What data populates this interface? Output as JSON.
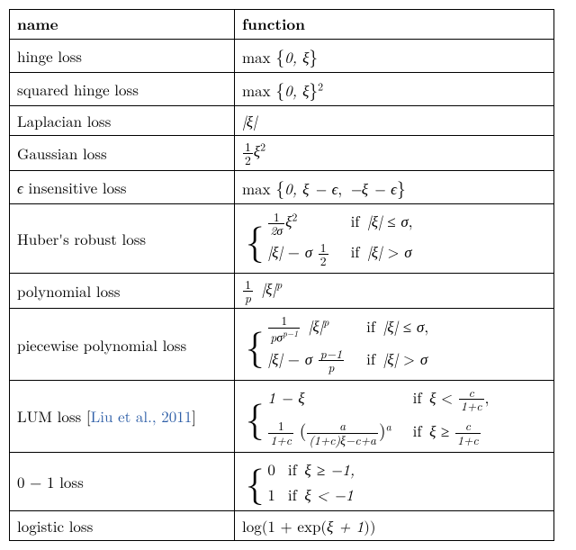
{
  "headers": {
    "name": "name",
    "function": "function"
  },
  "rows": {
    "hinge": {
      "name": "hinge loss"
    },
    "sqhinge": {
      "name": "squared hinge loss"
    },
    "laplacian": {
      "name": "Laplacian loss"
    },
    "gaussian": {
      "name": "Gaussian loss"
    },
    "eps": {
      "name_pre": "",
      "name_sym": "ϵ",
      "name_post": " insensitive loss"
    },
    "huber": {
      "name": "Huber's robust loss"
    },
    "poly": {
      "name": "polynomial loss"
    },
    "piecepoly": {
      "name": "piecewise polynomial loss"
    },
    "lum": {
      "name_pre": "LUM loss [",
      "cite": "Liu et al., 2011",
      "name_post": "]"
    },
    "zero_one": {
      "name": "0 − 1 loss"
    },
    "logistic": {
      "name": "logistic loss"
    }
  },
  "m": {
    "xi": "ξ",
    "eps": "ϵ",
    "sigma": "σ",
    "max": "max",
    "half": {
      "n": "1",
      "d": "2"
    },
    "one_over_p": {
      "n": "1",
      "d": "p"
    },
    "one_over_2sigma": {
      "n": "1",
      "d": "2σ"
    },
    "one_over_poly": {
      "n": "1",
      "d_pre": "pσ",
      "d_exp": "p−1"
    },
    "pminus1_over_p": {
      "n": "p−1",
      "d": "p"
    },
    "one_over_1pc": {
      "n": "1",
      "d": "1+c"
    },
    "c_over_1pc": {
      "n": "c",
      "d": "1+c"
    },
    "a_over_den": {
      "n": "a",
      "d": "(1+c)ξ−c+a"
    },
    "if": "if",
    "zero": "0",
    "one": "1",
    "p": "p",
    "a": "a",
    "two": "2",
    "log": "log",
    "exp": "exp",
    "plus1": " + 1",
    "one_plus": "1 + ",
    "lbrace": "{",
    "rbrace": "}",
    "lparen": "(",
    "rparen": ")",
    "comma0xi": "0, ξ",
    "abs_xi": "|ξ|",
    "ge": " ≥ ",
    "le": " ≤ ",
    "gt": " > ",
    "lt": " < ",
    "minus": " − ",
    "minus_eps_minus_xi": "−ξ − ϵ",
    "xi_minus_eps": "ξ − ϵ",
    "zero_comma": "0, ",
    "one_minus_xi": "1 − ξ",
    "neg1": "−1",
    "xi_plus_1": "ξ + 1",
    "xi_ge_neg1": "ξ ≥ −1,",
    "xi_lt_neg1": "ξ < −1"
  },
  "chart_data": {
    "type": "table",
    "title": "Loss functions",
    "columns": [
      "name",
      "function"
    ],
    "rows": [
      {
        "name": "hinge loss",
        "function": "max{0, ξ}"
      },
      {
        "name": "squared hinge loss",
        "function": "max{0, ξ}^2"
      },
      {
        "name": "Laplacian loss",
        "function": "|ξ|"
      },
      {
        "name": "Gaussian loss",
        "function": "(1/2) ξ^2"
      },
      {
        "name": "ϵ insensitive loss",
        "function": "max{0, ξ − ϵ, −ξ − ϵ}"
      },
      {
        "name": "Huber's robust loss",
        "function": "{ (1/(2σ)) ξ^2  if |ξ| ≤ σ,  |ξ| − σ (1/2)  if |ξ| > σ"
      },
      {
        "name": "polynomial loss",
        "function": "(1/p) |ξ|^p"
      },
      {
        "name": "piecewise polynomial loss",
        "function": "{ (1/(p σ^{p−1})) |ξ|^p  if |ξ| ≤ σ,  |ξ| − σ (p−1)/p  if |ξ| > σ"
      },
      {
        "name": "LUM loss [Liu et al., 2011]",
        "function": "{ 1 − ξ  if ξ < c/(1+c),  (1/(1+c)) ( a / ((1+c)ξ − c + a) )^a  if ξ ≥ c/(1+c)"
      },
      {
        "name": "0 − 1 loss",
        "function": "{ 0  if ξ ≥ −1,  1  if ξ < −1"
      },
      {
        "name": "logistic loss",
        "function": "log(1 + exp(ξ + 1))"
      }
    ]
  }
}
